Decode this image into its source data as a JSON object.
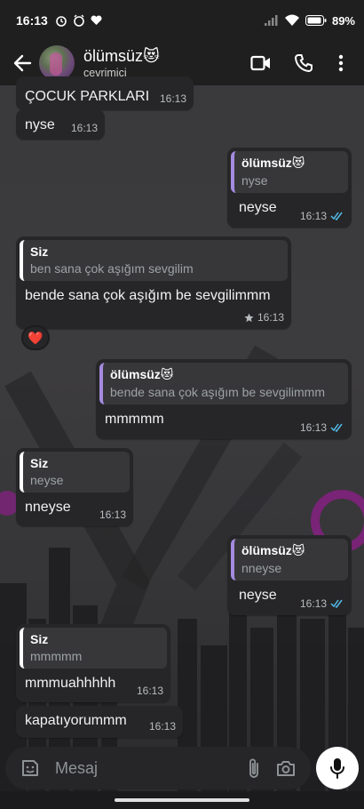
{
  "status_bar": {
    "time": "16:13",
    "battery": "89%"
  },
  "header": {
    "contact_name": "ölümsüz😻",
    "contact_status": "çevrimiçi"
  },
  "messages": [
    {
      "dir": "in",
      "text": "ÇOCUK PARKLARI",
      "time": "16:13"
    },
    {
      "dir": "in",
      "text": "nyse",
      "time": "16:13"
    },
    {
      "dir": "out",
      "quote_author": "ölümsüz😻",
      "quote_text": "nyse",
      "text": "neyse",
      "time": "16:13",
      "read": true
    },
    {
      "dir": "in",
      "quote_author": "Siz",
      "quote_text": "ben sana çok aşığım sevgilim",
      "text": "bende sana çok aşığım be sevgilimmm",
      "time": "16:13",
      "starred": true,
      "reaction": "❤️"
    },
    {
      "dir": "out",
      "quote_author": "ölümsüz😻",
      "quote_text": "bende sana çok aşığım be sevgilimmm",
      "text": "mmmmm",
      "time": "16:13",
      "read": true
    },
    {
      "dir": "in",
      "quote_author": "Siz",
      "quote_text": "neyse",
      "text": "nneyse",
      "time": "16:13"
    },
    {
      "dir": "out",
      "quote_author": "ölümsüz😻",
      "quote_text": "nneyse",
      "text": "neyse",
      "time": "16:13",
      "read": true
    },
    {
      "dir": "in",
      "quote_author": "Siz",
      "quote_text": "mmmmm",
      "text": "mmmuahhhhh",
      "time": "16:13"
    },
    {
      "dir": "in",
      "text": "kapatıyorummm",
      "time": "16:13"
    }
  ],
  "composer": {
    "placeholder": "Mesaj"
  },
  "colors": {
    "bubble": "#262628",
    "quote_bg": "#37373a",
    "quote_accent_contact": "#a58be0",
    "read_tick": "#53bdeb",
    "header_bg": "#1f1f1f"
  }
}
